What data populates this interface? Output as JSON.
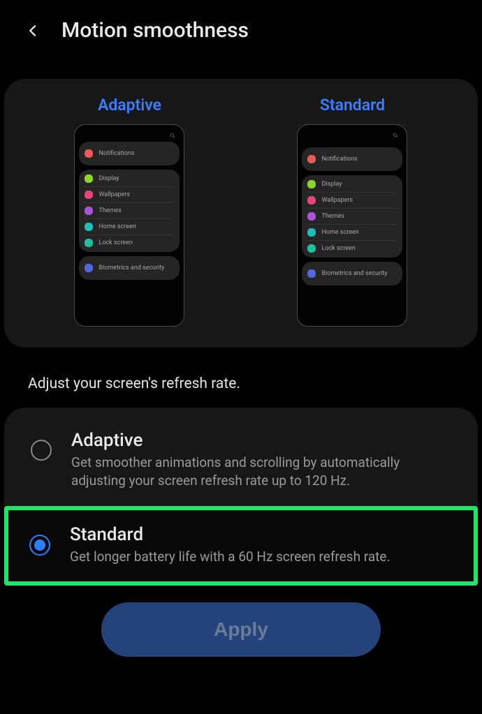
{
  "header": {
    "title": "Motion smoothness"
  },
  "preview": {
    "left_label": "Adaptive",
    "right_label": "Standard",
    "items": {
      "notifications": "Notifications",
      "display": "Display",
      "wallpapers": "Wallpapers",
      "themes": "Themes",
      "home": "Home screen",
      "lock": "Lock screen",
      "biometrics": "Biometrics and security"
    }
  },
  "section_label": "Adjust your screen's refresh rate.",
  "options": {
    "adaptive": {
      "title": "Adaptive",
      "desc": "Get smoother animations and scrolling by automatically adjusting your screen refresh rate up to 120 Hz.",
      "selected": false
    },
    "standard": {
      "title": "Standard",
      "desc": "Get longer battery life with a 60 Hz screen refresh rate.",
      "selected": true
    }
  },
  "apply_label": "Apply"
}
